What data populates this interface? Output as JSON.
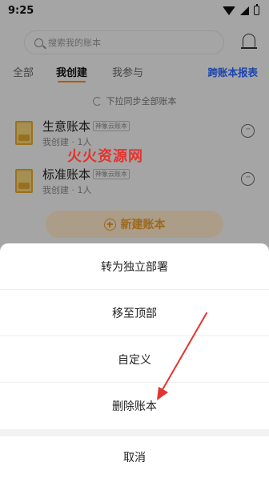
{
  "status_bar": {
    "time": "9:25"
  },
  "search": {
    "placeholder": "搜索我的账本"
  },
  "tabs": [
    {
      "label": "全部"
    },
    {
      "label": "我创建"
    },
    {
      "label": "我参与"
    }
  ],
  "cross_ledger_report": "跨账本报表",
  "sync_hint": "下拉同步全部账本",
  "ledgers": [
    {
      "name": "生意账本",
      "tag": "神象云账本",
      "meta": "我创建  ·  1人"
    },
    {
      "name": "标准账本",
      "tag": "神象云账本",
      "meta": "我创建  ·  1人"
    }
  ],
  "watermark": "火火资源网",
  "create_button": "新建账本",
  "sheet": {
    "items": [
      "转为独立部署",
      "移至顶部",
      "自定义",
      "删除账本"
    ],
    "cancel": "取消"
  },
  "colors": {
    "accent": "#ff8a00",
    "link": "#2a66ff",
    "annotation_arrow": "#e3342f"
  }
}
